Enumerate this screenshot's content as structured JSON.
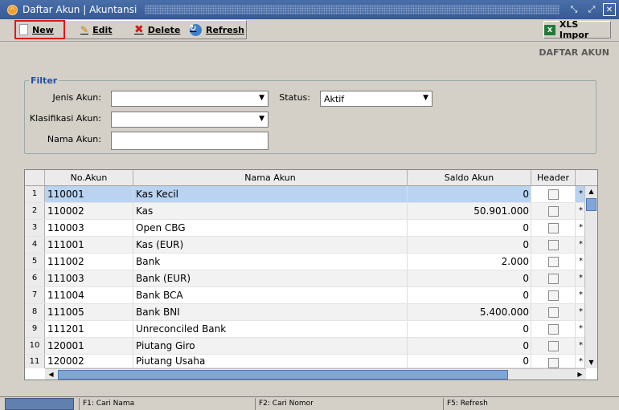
{
  "window": {
    "title": "Daftar Akun | Akuntansi"
  },
  "toolbar": {
    "new": "New",
    "edit": "Edit",
    "delete": "Delete",
    "refresh": "Refresh",
    "xls_import": "XLS Impor"
  },
  "section_title": "DAFTAR AKUN",
  "filter": {
    "legend": "Filter",
    "jenis_akun_label": "Jenis Akun:",
    "jenis_akun_value": "",
    "status_label": "Status:",
    "status_value": "Aktif",
    "klasifikasi_label": "Klasifikasi Akun:",
    "klasifikasi_value": "",
    "nama_akun_label": "Nama Akun:",
    "nama_akun_value": ""
  },
  "grid": {
    "columns": [
      "No.Akun",
      "Nama Akun",
      "Saldo Akun",
      "Header"
    ],
    "rows": [
      {
        "idx": "1",
        "no": "110001",
        "name": "Kas Kecil",
        "saldo": "0",
        "star": "*"
      },
      {
        "idx": "2",
        "no": "110002",
        "name": "Kas",
        "saldo": "50.901.000",
        "star": "*"
      },
      {
        "idx": "3",
        "no": "110003",
        "name": "Open CBG",
        "saldo": "0",
        "star": "*"
      },
      {
        "idx": "4",
        "no": "111001",
        "name": "Kas (EUR)",
        "saldo": "0",
        "star": "*"
      },
      {
        "idx": "5",
        "no": "111002",
        "name": "Bank",
        "saldo": "2.000",
        "star": "*"
      },
      {
        "idx": "6",
        "no": "111003",
        "name": "Bank (EUR)",
        "saldo": "0",
        "star": "*"
      },
      {
        "idx": "7",
        "no": "111004",
        "name": "Bank BCA",
        "saldo": "0",
        "star": "*"
      },
      {
        "idx": "8",
        "no": "111005",
        "name": "Bank BNI",
        "saldo": "5.400.000",
        "star": "*"
      },
      {
        "idx": "9",
        "no": "111201",
        "name": "Unreconciled Bank",
        "saldo": "0",
        "star": "*"
      },
      {
        "idx": "10",
        "no": "120001",
        "name": "Piutang Giro",
        "saldo": "0",
        "star": "*"
      },
      {
        "idx": "11",
        "no": "120002",
        "name": "Piutang Usaha",
        "saldo": "0",
        "star": "*"
      }
    ]
  },
  "statusbar": {
    "f1": "F1: Cari Nama",
    "f2": "F2: Cari Nomor",
    "f5": "F5: Refresh"
  }
}
